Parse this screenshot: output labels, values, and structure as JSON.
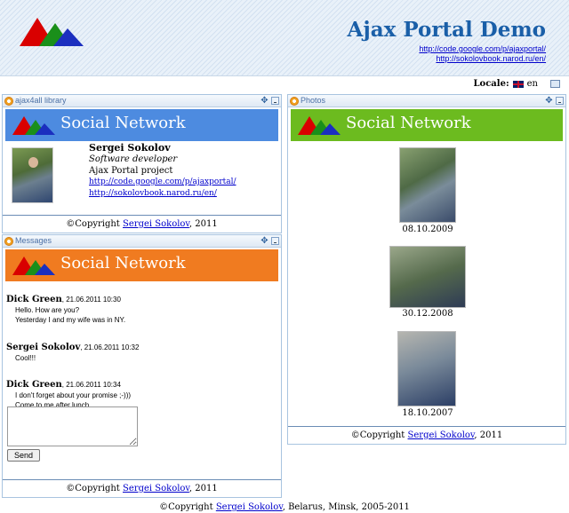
{
  "header": {
    "title": "Ajax Portal Demo",
    "link1": "http://code.google.com/p/ajaxportal/",
    "link2": "http://sokolovbook.narod.ru/en/"
  },
  "locale": {
    "label": "Locale:",
    "value": "en"
  },
  "portlets": {
    "library": {
      "title": "ajax4all library",
      "banner": "Social Network",
      "banner_color": "#4d8be0",
      "profile": {
        "name": "Sergei Sokolov",
        "role": "Software developer",
        "project": "Ajax Portal project",
        "link1": "http://code.google.com/p/ajaxportal/",
        "link2": "http://sokolovbook.narod.ru/en/"
      },
      "footer_prefix": "©Copyright ",
      "footer_link": "Sergei Sokolov",
      "footer_suffix": ", 2011"
    },
    "messages": {
      "title": "Messages",
      "banner": "Social Network",
      "banner_color": "#f07b20",
      "items": [
        {
          "author": "Dick Green",
          "time": ", 21.06.2011 10:30",
          "lines": [
            "Hello. How are you?",
            "Yesterday I and my wife was in NY."
          ]
        },
        {
          "author": "Sergei Sokolov",
          "time": ", 21.06.2011 10:32",
          "lines": [
            "Cool!!!"
          ]
        },
        {
          "author": "Dick Green",
          "time": ", 21.06.2011 10:34",
          "lines": [
            "I don't forget about your promise ;-)))",
            "Come to me after lunch..."
          ]
        }
      ],
      "textarea_value": "",
      "send_label": "Send",
      "footer_prefix": "©Copyright ",
      "footer_link": "Sergei Sokolov",
      "footer_suffix": ", 2011"
    },
    "photos": {
      "title": "Photos",
      "banner": "Social Network",
      "banner_color": "#6cbb1f",
      "items": [
        {
          "date": "08.10.2009"
        },
        {
          "date": "30.12.2008"
        },
        {
          "date": "18.10.2007"
        }
      ],
      "footer_prefix": "©Copyright ",
      "footer_link": "Sergei Sokolov",
      "footer_suffix": ", 2011"
    }
  },
  "page_footer": {
    "prefix": "©Copyright ",
    "link": "Sergei Sokolov",
    "suffix": ", Belarus, Minsk, 2005-2011"
  }
}
